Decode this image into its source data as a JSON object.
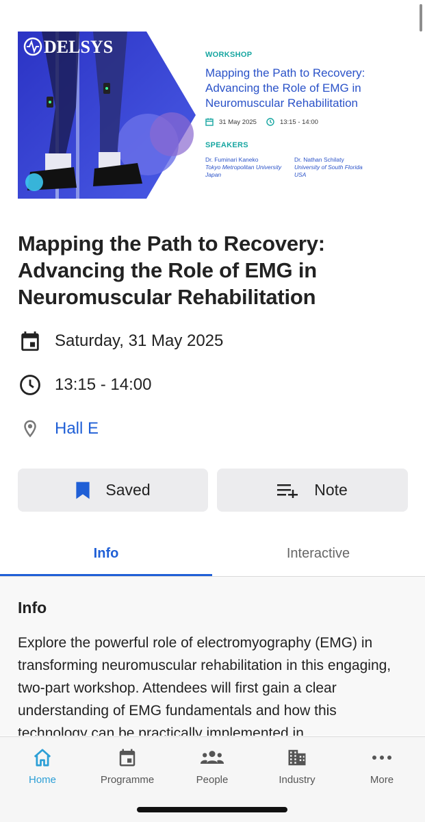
{
  "banner": {
    "brand": "DELSYS",
    "kicker": "WORKSHOP",
    "title": "Mapping the Path to Recovery: Advancing the Role of EMG in Neuromuscular Rehabilitation",
    "date": "31 May 2025",
    "time": "13:15 - 14:00",
    "speakers_label": "SPEAKERS",
    "speakers": [
      {
        "name": "Dr. Fuminari Kaneko",
        "affiliation": "Tokyo Metropolitan University",
        "country": "Japan"
      },
      {
        "name": "Dr. Nathan Schilaty",
        "affiliation": "University of South Florida",
        "country": "USA"
      }
    ],
    "colors": {
      "accent_teal": "#17a6a1",
      "accent_blue": "#2a52c8",
      "photo_blue": "#3a46d8"
    }
  },
  "event": {
    "title": "Mapping the Path to Recovery: Advancing the Role of EMG in Neuromuscular Rehabilitation",
    "date": "Saturday, 31 May 2025",
    "time": "13:15 - 14:00",
    "location": "Hall E",
    "icons": {
      "date": "calendar-icon",
      "time": "clock-icon",
      "location": "location-pin-icon"
    }
  },
  "actions": {
    "saved_label": "Saved",
    "note_label": "Note",
    "icons": {
      "saved": "bookmark-icon",
      "note": "add-note-icon"
    }
  },
  "tabs": [
    {
      "label": "Info",
      "active": true
    },
    {
      "label": "Interactive",
      "active": false
    }
  ],
  "info": {
    "heading": "Info",
    "body": "Explore the powerful role of electromyography (EMG) in transforming neuromuscular rehabilitation in this engaging, two-part workshop. Attendees will first gain a clear understanding of EMG fundamentals and how this technology can be practically implemented in"
  },
  "bottom_nav": {
    "items": [
      {
        "label": "Home",
        "icon": "home-icon",
        "active": true
      },
      {
        "label": "Programme",
        "icon": "calendar-icon",
        "active": false
      },
      {
        "label": "People",
        "icon": "people-icon",
        "active": false
      },
      {
        "label": "Industry",
        "icon": "building-icon",
        "active": false
      },
      {
        "label": "More",
        "icon": "more-icon",
        "active": false
      }
    ],
    "colors": {
      "active": "#2c9fd6",
      "inactive": "#555555"
    }
  },
  "theme": {
    "link_blue": "#1f5fd6",
    "button_bg": "#ececee"
  }
}
